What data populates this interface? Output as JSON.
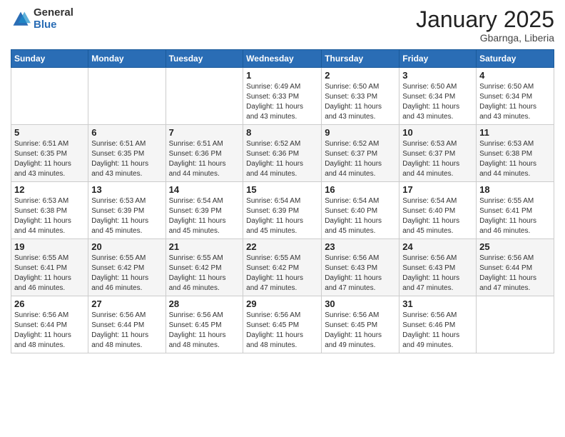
{
  "header": {
    "logo_general": "General",
    "logo_blue": "Blue",
    "month_title": "January 2025",
    "subtitle": "Gbarnga, Liberia"
  },
  "weekdays": [
    "Sunday",
    "Monday",
    "Tuesday",
    "Wednesday",
    "Thursday",
    "Friday",
    "Saturday"
  ],
  "weeks": [
    [
      {
        "day": "",
        "info": ""
      },
      {
        "day": "",
        "info": ""
      },
      {
        "day": "",
        "info": ""
      },
      {
        "day": "1",
        "info": "Sunrise: 6:49 AM\nSunset: 6:33 PM\nDaylight: 11 hours\nand 43 minutes."
      },
      {
        "day": "2",
        "info": "Sunrise: 6:50 AM\nSunset: 6:33 PM\nDaylight: 11 hours\nand 43 minutes."
      },
      {
        "day": "3",
        "info": "Sunrise: 6:50 AM\nSunset: 6:34 PM\nDaylight: 11 hours\nand 43 minutes."
      },
      {
        "day": "4",
        "info": "Sunrise: 6:50 AM\nSunset: 6:34 PM\nDaylight: 11 hours\nand 43 minutes."
      }
    ],
    [
      {
        "day": "5",
        "info": "Sunrise: 6:51 AM\nSunset: 6:35 PM\nDaylight: 11 hours\nand 43 minutes."
      },
      {
        "day": "6",
        "info": "Sunrise: 6:51 AM\nSunset: 6:35 PM\nDaylight: 11 hours\nand 43 minutes."
      },
      {
        "day": "7",
        "info": "Sunrise: 6:51 AM\nSunset: 6:36 PM\nDaylight: 11 hours\nand 44 minutes."
      },
      {
        "day": "8",
        "info": "Sunrise: 6:52 AM\nSunset: 6:36 PM\nDaylight: 11 hours\nand 44 minutes."
      },
      {
        "day": "9",
        "info": "Sunrise: 6:52 AM\nSunset: 6:37 PM\nDaylight: 11 hours\nand 44 minutes."
      },
      {
        "day": "10",
        "info": "Sunrise: 6:53 AM\nSunset: 6:37 PM\nDaylight: 11 hours\nand 44 minutes."
      },
      {
        "day": "11",
        "info": "Sunrise: 6:53 AM\nSunset: 6:38 PM\nDaylight: 11 hours\nand 44 minutes."
      }
    ],
    [
      {
        "day": "12",
        "info": "Sunrise: 6:53 AM\nSunset: 6:38 PM\nDaylight: 11 hours\nand 44 minutes."
      },
      {
        "day": "13",
        "info": "Sunrise: 6:53 AM\nSunset: 6:39 PM\nDaylight: 11 hours\nand 45 minutes."
      },
      {
        "day": "14",
        "info": "Sunrise: 6:54 AM\nSunset: 6:39 PM\nDaylight: 11 hours\nand 45 minutes."
      },
      {
        "day": "15",
        "info": "Sunrise: 6:54 AM\nSunset: 6:39 PM\nDaylight: 11 hours\nand 45 minutes."
      },
      {
        "day": "16",
        "info": "Sunrise: 6:54 AM\nSunset: 6:40 PM\nDaylight: 11 hours\nand 45 minutes."
      },
      {
        "day": "17",
        "info": "Sunrise: 6:54 AM\nSunset: 6:40 PM\nDaylight: 11 hours\nand 45 minutes."
      },
      {
        "day": "18",
        "info": "Sunrise: 6:55 AM\nSunset: 6:41 PM\nDaylight: 11 hours\nand 46 minutes."
      }
    ],
    [
      {
        "day": "19",
        "info": "Sunrise: 6:55 AM\nSunset: 6:41 PM\nDaylight: 11 hours\nand 46 minutes."
      },
      {
        "day": "20",
        "info": "Sunrise: 6:55 AM\nSunset: 6:42 PM\nDaylight: 11 hours\nand 46 minutes."
      },
      {
        "day": "21",
        "info": "Sunrise: 6:55 AM\nSunset: 6:42 PM\nDaylight: 11 hours\nand 46 minutes."
      },
      {
        "day": "22",
        "info": "Sunrise: 6:55 AM\nSunset: 6:42 PM\nDaylight: 11 hours\nand 47 minutes."
      },
      {
        "day": "23",
        "info": "Sunrise: 6:56 AM\nSunset: 6:43 PM\nDaylight: 11 hours\nand 47 minutes."
      },
      {
        "day": "24",
        "info": "Sunrise: 6:56 AM\nSunset: 6:43 PM\nDaylight: 11 hours\nand 47 minutes."
      },
      {
        "day": "25",
        "info": "Sunrise: 6:56 AM\nSunset: 6:44 PM\nDaylight: 11 hours\nand 47 minutes."
      }
    ],
    [
      {
        "day": "26",
        "info": "Sunrise: 6:56 AM\nSunset: 6:44 PM\nDaylight: 11 hours\nand 48 minutes."
      },
      {
        "day": "27",
        "info": "Sunrise: 6:56 AM\nSunset: 6:44 PM\nDaylight: 11 hours\nand 48 minutes."
      },
      {
        "day": "28",
        "info": "Sunrise: 6:56 AM\nSunset: 6:45 PM\nDaylight: 11 hours\nand 48 minutes."
      },
      {
        "day": "29",
        "info": "Sunrise: 6:56 AM\nSunset: 6:45 PM\nDaylight: 11 hours\nand 48 minutes."
      },
      {
        "day": "30",
        "info": "Sunrise: 6:56 AM\nSunset: 6:45 PM\nDaylight: 11 hours\nand 49 minutes."
      },
      {
        "day": "31",
        "info": "Sunrise: 6:56 AM\nSunset: 6:46 PM\nDaylight: 11 hours\nand 49 minutes."
      },
      {
        "day": "",
        "info": ""
      }
    ]
  ]
}
